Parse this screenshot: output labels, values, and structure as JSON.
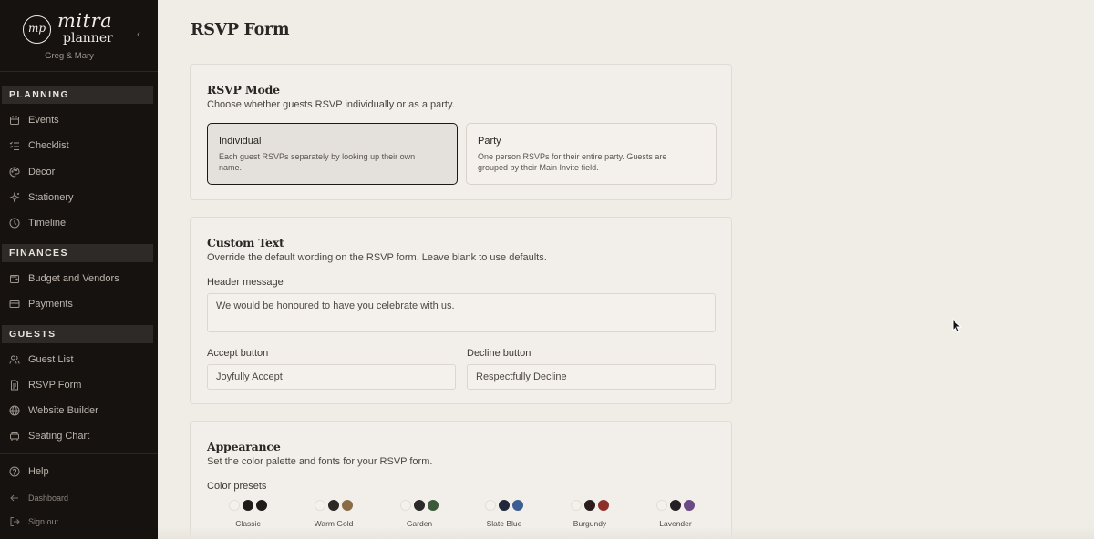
{
  "brand": {
    "monogram": "mp",
    "name_script": "mitra",
    "name_plain": "planner",
    "couple": "Greg & Mary"
  },
  "sidebar": {
    "sections": [
      {
        "label": "PLANNING",
        "items": [
          {
            "label": "Events",
            "icon": "calendar-icon"
          },
          {
            "label": "Checklist",
            "icon": "checklist-icon"
          },
          {
            "label": "Décor",
            "icon": "palette-icon"
          },
          {
            "label": "Stationery",
            "icon": "sparkle-icon"
          },
          {
            "label": "Timeline",
            "icon": "clock-icon"
          }
        ]
      },
      {
        "label": "FINANCES",
        "items": [
          {
            "label": "Budget and Vendors",
            "icon": "wallet-icon"
          },
          {
            "label": "Payments",
            "icon": "card-icon"
          }
        ]
      },
      {
        "label": "GUESTS",
        "items": [
          {
            "label": "Guest List",
            "icon": "users-icon"
          },
          {
            "label": "RSVP Form",
            "icon": "document-icon"
          },
          {
            "label": "Website Builder",
            "icon": "globe-icon"
          },
          {
            "label": "Seating Chart",
            "icon": "seat-icon"
          }
        ]
      }
    ],
    "footer": {
      "help": "Help",
      "dashboard": "Dashboard",
      "signout": "Sign out"
    }
  },
  "page": {
    "title": "RSVP Form"
  },
  "rsvp_mode": {
    "title": "RSVP Mode",
    "description": "Choose whether guests RSVP individually or as a party.",
    "options": [
      {
        "title": "Individual",
        "description": "Each guest RSVPs separately by looking up their own name.",
        "selected": true
      },
      {
        "title": "Party",
        "description": "One person RSVPs for their entire party. Guests are grouped by their Main Invite field.",
        "selected": false
      }
    ]
  },
  "custom_text": {
    "title": "Custom Text",
    "description": "Override the default wording on the RSVP form. Leave blank to use defaults.",
    "header_label": "Header message",
    "header_placeholder": "We would be honoured to have you celebrate with us.",
    "accept_label": "Accept button",
    "accept_placeholder": "Joyfully Accept",
    "decline_label": "Decline button",
    "decline_placeholder": "Respectfully Decline"
  },
  "appearance": {
    "title": "Appearance",
    "description": "Set the color palette and fonts for your RSVP form.",
    "presets_label": "Color presets",
    "presets": [
      {
        "name": "Classic",
        "colors": [
          "#f4f1ed",
          "#1f1b19",
          "#1f1b19"
        ]
      },
      {
        "name": "Warm Gold",
        "colors": [
          "#f4f1ed",
          "#2c2826",
          "#8b6b45"
        ]
      },
      {
        "name": "Garden",
        "colors": [
          "#f4f1ed",
          "#2b2a28",
          "#3c5a3a"
        ]
      },
      {
        "name": "Slate Blue",
        "colors": [
          "#f4f1ed",
          "#20283a",
          "#3d5e93"
        ]
      },
      {
        "name": "Burgundy",
        "colors": [
          "#f4f1ed",
          "#2a1c1c",
          "#8e2f2a"
        ]
      },
      {
        "name": "Lavender",
        "colors": [
          "#f4f1ed",
          "#261f24",
          "#6a4b86"
        ]
      }
    ]
  }
}
